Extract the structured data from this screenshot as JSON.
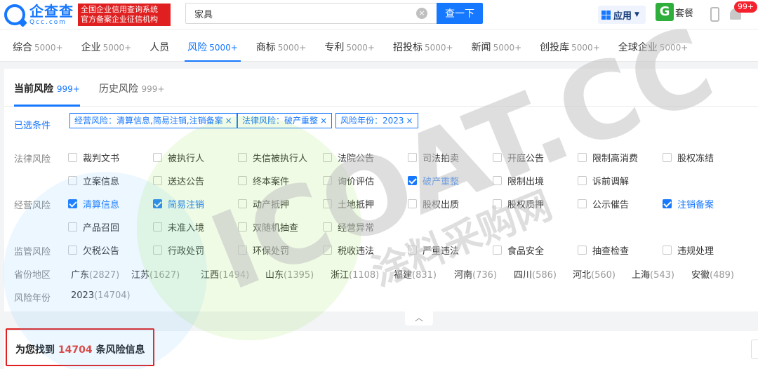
{
  "header": {
    "logo_name": "企查查",
    "logo_domain": "Qcc.com",
    "slogan_line1": "全国企业信用查询系统",
    "slogan_line2": "官方备案企业征信机构",
    "search_value": "家具",
    "search_button": "查一下",
    "app_label": "应用",
    "package_icon_letter": "G",
    "package_label": "套餐",
    "notification_badge": "99+"
  },
  "nav_tabs": [
    {
      "label": "综合",
      "count": "5000+"
    },
    {
      "label": "企业",
      "count": "5000+"
    },
    {
      "label": "人员",
      "count": ""
    },
    {
      "label": "风险",
      "count": "5000+",
      "active": true
    },
    {
      "label": "商标",
      "count": "5000+"
    },
    {
      "label": "专利",
      "count": "5000+"
    },
    {
      "label": "招投标",
      "count": "5000+"
    },
    {
      "label": "新闻",
      "count": "5000+"
    },
    {
      "label": "创投库",
      "count": "5000+"
    },
    {
      "label": "全球企业",
      "count": "5000+"
    }
  ],
  "risk_tabs": [
    {
      "label": "当前风险",
      "count": "999+",
      "active": true
    },
    {
      "label": "历史风险",
      "count": "999+"
    }
  ],
  "filters": {
    "selected_label": "已选条件",
    "chips": [
      "经营风险：清算信息,简易注销,注销备案",
      "法律风险：破产重整",
      "风险年份：2023"
    ],
    "chip_close": "×",
    "legal_label": "法律风险",
    "legal_options": [
      {
        "label": "裁判文书",
        "checked": false
      },
      {
        "label": "被执行人",
        "checked": false
      },
      {
        "label": "失信被执行人",
        "checked": false
      },
      {
        "label": "法院公告",
        "checked": false
      },
      {
        "label": "司法拍卖",
        "checked": false
      },
      {
        "label": "开庭公告",
        "checked": false
      },
      {
        "label": "限制高消费",
        "checked": false
      },
      {
        "label": "股权冻结",
        "checked": false
      },
      {
        "label": "立案信息",
        "checked": false
      },
      {
        "label": "送达公告",
        "checked": false
      },
      {
        "label": "终本案件",
        "checked": false
      },
      {
        "label": "询价评估",
        "checked": false
      },
      {
        "label": "破产重整",
        "checked": true
      },
      {
        "label": "限制出境",
        "checked": false
      },
      {
        "label": "诉前调解",
        "checked": false
      }
    ],
    "business_label": "经营风险",
    "business_options": [
      {
        "label": "清算信息",
        "checked": true
      },
      {
        "label": "简易注销",
        "checked": true
      },
      {
        "label": "动产抵押",
        "checked": false
      },
      {
        "label": "土地抵押",
        "checked": false
      },
      {
        "label": "股权出质",
        "checked": false
      },
      {
        "label": "股权质押",
        "checked": false
      },
      {
        "label": "公示催告",
        "checked": false
      },
      {
        "label": "注销备案",
        "checked": true
      },
      {
        "label": "产品召回",
        "checked": false
      },
      {
        "label": "未准入境",
        "checked": false
      },
      {
        "label": "双随机抽查",
        "checked": false
      },
      {
        "label": "经营异常",
        "checked": false
      }
    ],
    "supervision_label": "监管风险",
    "supervision_options": [
      {
        "label": "欠税公告",
        "checked": false
      },
      {
        "label": "行政处罚",
        "checked": false
      },
      {
        "label": "环保处罚",
        "checked": false
      },
      {
        "label": "税收违法",
        "checked": false
      },
      {
        "label": "严重违法",
        "checked": false
      },
      {
        "label": "食品安全",
        "checked": false
      },
      {
        "label": "抽查检查",
        "checked": false
      },
      {
        "label": "违规处理",
        "checked": false
      }
    ],
    "region_label": "省份地区",
    "regions": [
      {
        "name": "广东",
        "count": "(2827)"
      },
      {
        "name": "江苏",
        "count": "(1627)"
      },
      {
        "name": "江西",
        "count": "(1494)"
      },
      {
        "name": "山东",
        "count": "(1395)"
      },
      {
        "name": "浙江",
        "count": "(1108)"
      },
      {
        "name": "福建",
        "count": "(831)"
      },
      {
        "name": "河南",
        "count": "(736)"
      },
      {
        "name": "四川",
        "count": "(586)"
      },
      {
        "name": "河北",
        "count": "(560)"
      },
      {
        "name": "上海",
        "count": "(543)"
      },
      {
        "name": "安徽",
        "count": "(489)"
      }
    ],
    "year_label": "风险年份",
    "years": [
      {
        "name": "2023",
        "count": "(14704)"
      }
    ],
    "collapse_icon": "︿"
  },
  "result": {
    "prefix": "为您找到",
    "count": "14704",
    "suffix": "条风险信息"
  },
  "watermark": {
    "latin": "ICOAT.CC",
    "chinese": "涂料采购网"
  }
}
